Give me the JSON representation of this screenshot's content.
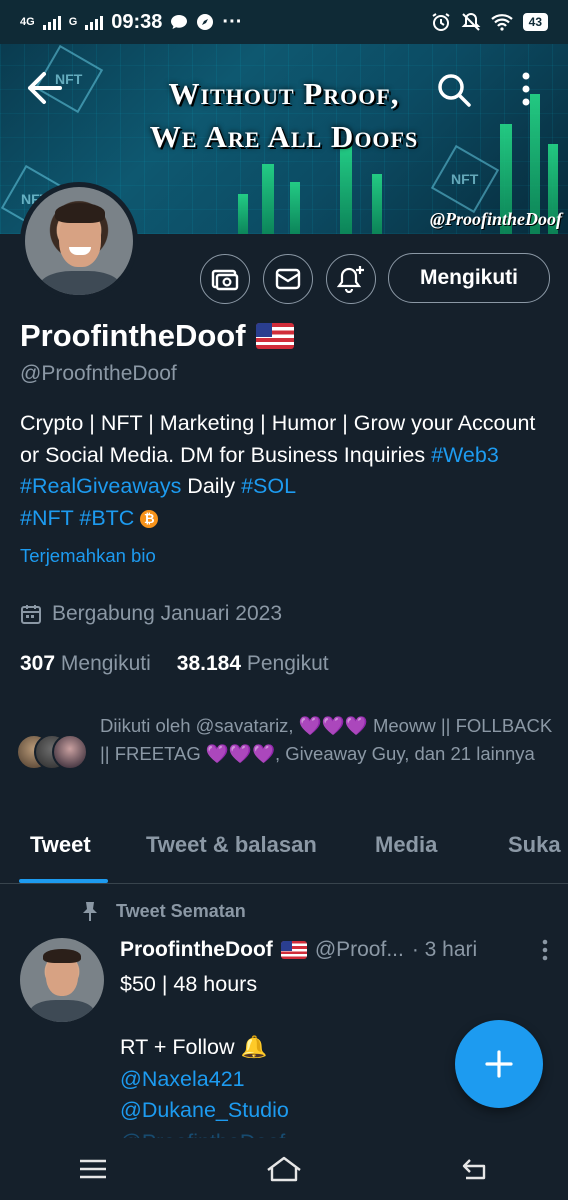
{
  "status_bar": {
    "network_left": "4G",
    "network_right": "G",
    "time": "09:38",
    "dots": "···",
    "battery": "43"
  },
  "banner": {
    "title_line1": "Without Proof,",
    "title_line2": "We Are All Doofs",
    "handle": "@ProofintheDoof",
    "hex_label": "NFT"
  },
  "profile": {
    "name": "ProofintheDoof",
    "handle": "@ProofntheDoof",
    "bio_text1": "Crypto | NFT | Marketing | Humor | Grow your Account or Social Media. DM for Business Inquiries ",
    "bio_tag1": "#Web3",
    "bio_tag2": "#RealGiveaways",
    "bio_text2": " Daily ",
    "bio_tag3": "#SOL",
    "bio_tag4": "#NFT",
    "bio_tag5": "#BTC",
    "bio_btc_glyph": "₿",
    "translate_bio": "Terjemahkan bio",
    "joined": "Bergabung Januari 2023",
    "following_count": "307",
    "following_label": "Mengikuti",
    "followers_count": "38.184",
    "followers_label": "Pengikut",
    "followed_by": "Diikuti oleh @savatariz,",
    "followed_hearts": "💜💜💜",
    "followed_mid": "Meoww || FOLLBACK || FREETAG",
    "followed_end": ", Giveaway Guy, dan 21 lainnya",
    "follow_button": "Mengikuti"
  },
  "tabs": [
    "Tweet",
    "Tweet & balasan",
    "Media",
    "Suka"
  ],
  "pinned_tweet": {
    "pinned_label": "Tweet Sematan",
    "author": "ProofintheDoof",
    "handle": "@Proof...",
    "time": "· 3 hari",
    "line1": "$50 | 48 hours",
    "line2": "RT + Follow 🔔",
    "mention1": "@Naxela421",
    "mention2": "@Dukane_Studio",
    "mention3": "@ProofintheDoof"
  },
  "colors": {
    "background": "#15202b",
    "accent": "#1d9bf0",
    "secondary_text": "#8b98a5"
  },
  "icons": [
    "back-arrow-icon",
    "search-icon",
    "more-vertical-icon",
    "tip-jar-icon",
    "mail-icon",
    "bell-plus-icon",
    "calendar-icon",
    "pin-icon",
    "compose-plus-icon",
    "menu-icon",
    "home-icon",
    "back-icon"
  ]
}
